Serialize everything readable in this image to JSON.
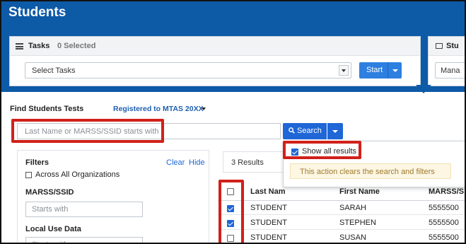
{
  "page": {
    "title": "Students"
  },
  "tasks": {
    "label": "Tasks",
    "selected_count": "0 Selected",
    "select_value": "Select Tasks",
    "start_label": "Start"
  },
  "students_card": {
    "label": "Stu",
    "select_value": "Mana"
  },
  "find": {
    "label": "Find Students Tests",
    "registered_label": "Registered to MTAS 20XX",
    "search_placeholder": "Last Name or MARSS/SSID starts with",
    "search_button": "Search"
  },
  "search_dropdown": {
    "show_all_label": "Show all results",
    "show_all_checked": true,
    "notice": "This action clears the search and filters"
  },
  "filters": {
    "title": "Filters",
    "clear": "Clear",
    "hide": "Hide",
    "across_all_orgs": "Across All Organizations",
    "marss_label": "MARSS/SSID",
    "marss_placeholder": "Starts with",
    "local_use_label": "Local Use Data",
    "local_use_placeholder": "Starts with"
  },
  "results": {
    "count_label": "3 Results",
    "columns": [
      "Last Nam",
      "First Name",
      "MARSS/S"
    ],
    "rows": [
      {
        "checked": true,
        "last": "STUDENT",
        "first": "SARAH",
        "marss": "5555500"
      },
      {
        "checked": true,
        "last": "STUDENT",
        "first": "STEPHEN",
        "marss": "5555500"
      },
      {
        "checked": false,
        "last": "STUDENT",
        "first": "SUSAN",
        "marss": "5555500"
      }
    ]
  },
  "colors": {
    "header_blue": "#0d5aa7",
    "button_blue": "#1f66d6",
    "highlight_red": "#d0211a",
    "notice_bg": "#fcf6e3"
  }
}
